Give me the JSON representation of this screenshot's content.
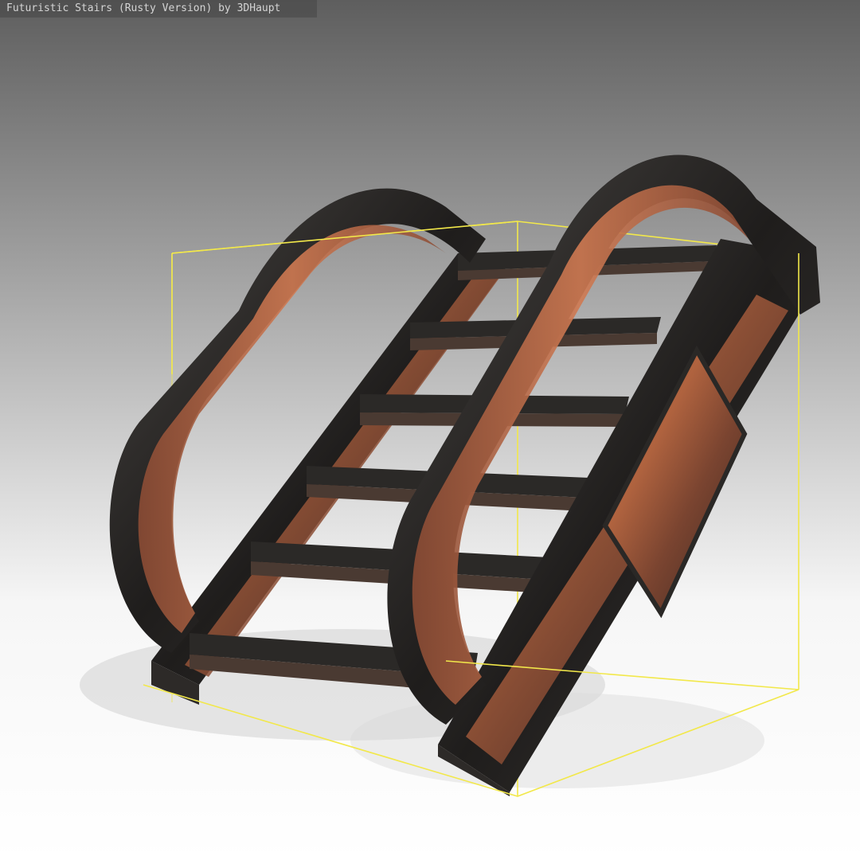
{
  "viewer": {
    "title": "Futuristic Stairs (Rusty Version) by 3DHaupt",
    "bounding_box_color": "#f2e84a",
    "rust_color": "#a45a3a",
    "metal_color": "#2a2826",
    "background_top": "#5e5e5e",
    "background_bottom": "#ffffff"
  }
}
